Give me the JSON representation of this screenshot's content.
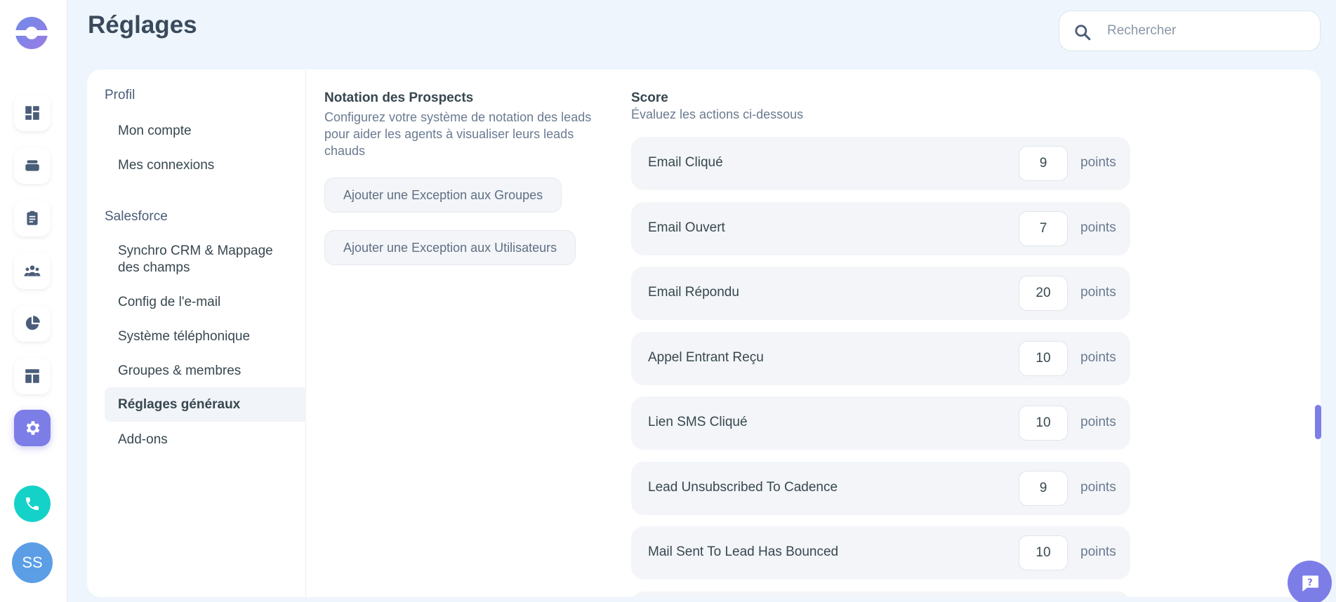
{
  "header": {
    "title": "Réglages",
    "search_placeholder": "Rechercher"
  },
  "rail": {
    "items": [
      "dashboard-icon",
      "layers-icon",
      "clipboard-icon",
      "team-icon",
      "pie-chart-icon",
      "layout-icon",
      "gear-icon"
    ],
    "active": "gear-icon",
    "avatar_initials": "SS"
  },
  "subnav": {
    "sections": [
      {
        "title": "Profil",
        "items": [
          "Mon compte",
          "Mes connexions"
        ]
      },
      {
        "title": "Salesforce",
        "items": [
          "Synchro CRM & Mappage des champs",
          "Config de l'e-mail",
          "Système téléphonique",
          "Groupes & membres",
          "Réglages généraux",
          "Add-ons"
        ]
      }
    ],
    "active_item": "Réglages généraux"
  },
  "lead_scoring": {
    "title": "Notation des Prospects",
    "description": "Configurez votre système de notation des leads pour aider les agents à visualiser leurs leads chauds",
    "buttons": [
      "Ajouter une Exception aux Groupes",
      "Ajouter une Exception aux Utilisateurs"
    ]
  },
  "score": {
    "title": "Score",
    "subtitle": "Évaluez les actions ci-dessous",
    "unit": "points",
    "rows": [
      {
        "label": "Email Cliqué",
        "value": "9"
      },
      {
        "label": "Email Ouvert",
        "value": "7"
      },
      {
        "label": "Email Répondu",
        "value": "20"
      },
      {
        "label": "Appel Entrant Reçu",
        "value": "10"
      },
      {
        "label": "Lien SMS Cliqué",
        "value": "10"
      },
      {
        "label": "Lead Unsubscribed To Cadence",
        "value": "9"
      },
      {
        "label": "Mail Sent To Lead Has Bounced",
        "value": "10"
      }
    ]
  },
  "colors": {
    "accent": "#7d7de8",
    "call": "#14d2c8",
    "avatar": "#5b9ee6",
    "background": "#eef5fc"
  }
}
